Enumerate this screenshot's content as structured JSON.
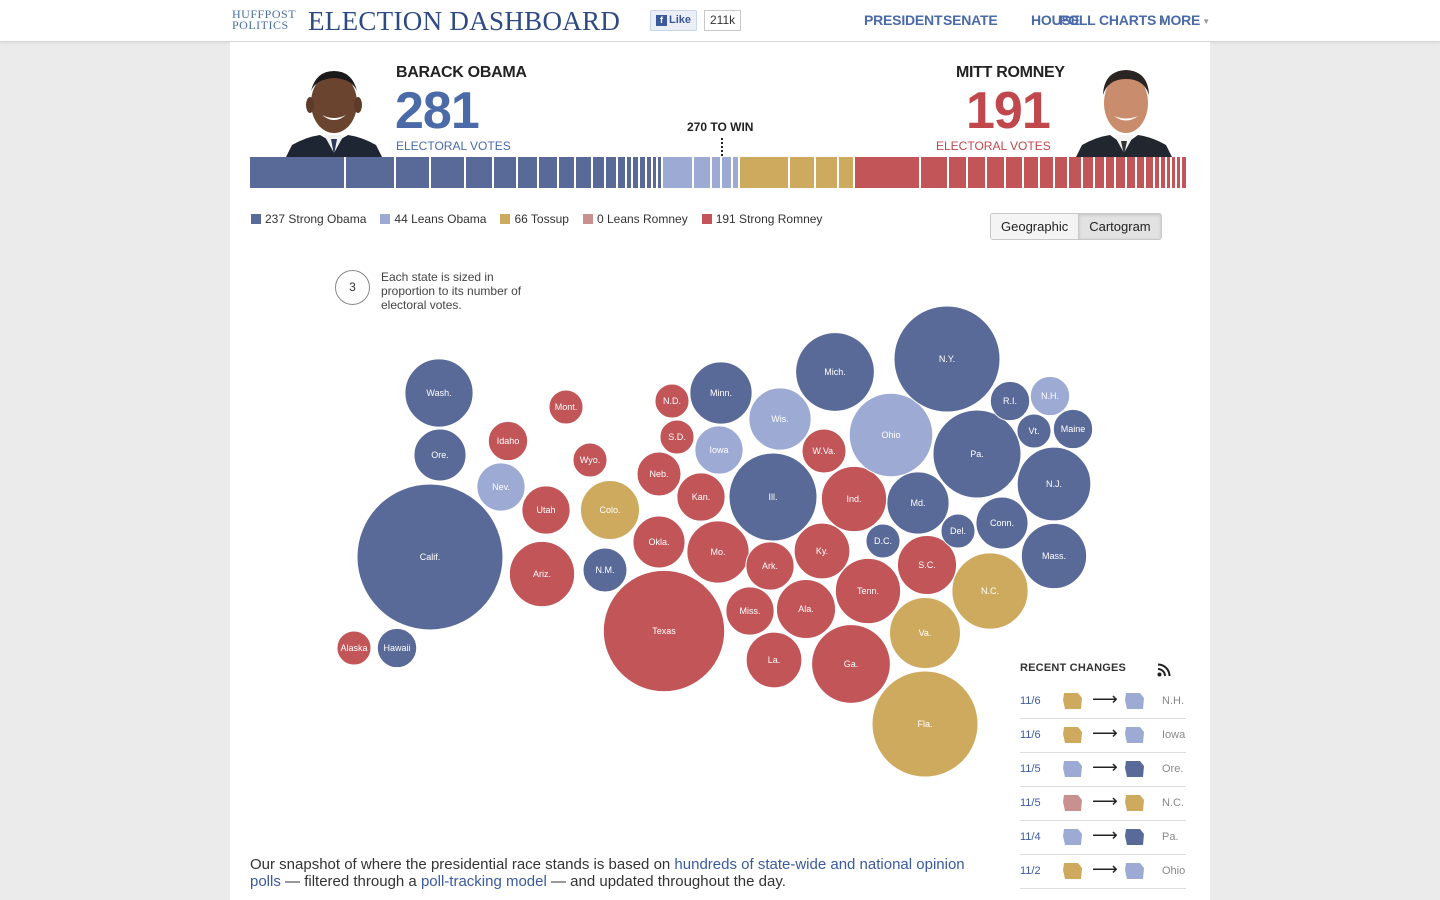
{
  "colors": {
    "strong_obama": "#5a6a98",
    "leans_obama": "#9daad4",
    "tossup": "#ceaa5e",
    "leans_romney": "#c99090",
    "strong_romney": "#c15558",
    "obama_text": "#4a6aa8",
    "romney_text": "#c0474c"
  },
  "header": {
    "logo_line1": "HUFFPOST",
    "logo_line2": "POLITICS",
    "title": "ELECTION DASHBOARD",
    "fb_like": "Like",
    "fb_count": "211k",
    "nav": [
      "PRESIDENT",
      "SENATE",
      "HOUSE",
      "POLL CHARTS",
      "MORE"
    ]
  },
  "obama": {
    "name": "BARACK OBAMA",
    "votes": "281",
    "label": "ELECTORAL VOTES"
  },
  "romney": {
    "name": "MITT ROMNEY",
    "votes": "191",
    "label": "ELECTORAL VOTES"
  },
  "to_win": "270 TO WIN",
  "legend": [
    {
      "key": "strong_obama",
      "label": "237 Strong Obama",
      "count": 237
    },
    {
      "key": "leans_obama",
      "label": "44 Leans Obama",
      "count": 44
    },
    {
      "key": "tossup",
      "label": "66 Tossup",
      "count": 66
    },
    {
      "key": "leans_romney",
      "label": "0 Leans Romney",
      "count": 0
    },
    {
      "key": "strong_romney",
      "label": "191 Strong Romney",
      "count": 191
    }
  ],
  "view_toggle": {
    "options": [
      "Geographic",
      "Cartogram"
    ],
    "selected": "Cartogram"
  },
  "size_note": {
    "example_votes": "3",
    "text": "Each state is sized in proportion to its number of electoral votes."
  },
  "states": [
    {
      "label": "Wash.",
      "ev": 12,
      "cat": "strong_obama"
    },
    {
      "label": "Ore.",
      "ev": 7,
      "cat": "strong_obama"
    },
    {
      "label": "Calif.",
      "ev": 55,
      "cat": "strong_obama"
    },
    {
      "label": "Alaska",
      "ev": 3,
      "cat": "strong_romney"
    },
    {
      "label": "Hawaii",
      "ev": 4,
      "cat": "strong_obama"
    },
    {
      "label": "Idaho",
      "ev": 4,
      "cat": "strong_romney"
    },
    {
      "label": "Nev.",
      "ev": 6,
      "cat": "leans_obama"
    },
    {
      "label": "Mont.",
      "ev": 3,
      "cat": "strong_romney"
    },
    {
      "label": "Wyo.",
      "ev": 3,
      "cat": "strong_romney"
    },
    {
      "label": "Utah",
      "ev": 6,
      "cat": "strong_romney"
    },
    {
      "label": "Colo.",
      "ev": 9,
      "cat": "tossup"
    },
    {
      "label": "Ariz.",
      "ev": 11,
      "cat": "strong_romney"
    },
    {
      "label": "N.M.",
      "ev": 5,
      "cat": "strong_obama"
    },
    {
      "label": "N.D.",
      "ev": 3,
      "cat": "strong_romney"
    },
    {
      "label": "S.D.",
      "ev": 3,
      "cat": "strong_romney"
    },
    {
      "label": "Neb.",
      "ev": 5,
      "cat": "strong_romney"
    },
    {
      "label": "Kan.",
      "ev": 6,
      "cat": "strong_romney"
    },
    {
      "label": "Okla.",
      "ev": 7,
      "cat": "strong_romney"
    },
    {
      "label": "Texas",
      "ev": 38,
      "cat": "strong_romney"
    },
    {
      "label": "Minn.",
      "ev": 10,
      "cat": "strong_obama"
    },
    {
      "label": "Iowa",
      "ev": 6,
      "cat": "leans_obama"
    },
    {
      "label": "Mo.",
      "ev": 10,
      "cat": "strong_romney"
    },
    {
      "label": "Ark.",
      "ev": 6,
      "cat": "strong_romney"
    },
    {
      "label": "La.",
      "ev": 8,
      "cat": "strong_romney"
    },
    {
      "label": "Miss.",
      "ev": 6,
      "cat": "strong_romney"
    },
    {
      "label": "Wis.",
      "ev": 10,
      "cat": "leans_obama"
    },
    {
      "label": "Ill.",
      "ev": 20,
      "cat": "strong_obama"
    },
    {
      "label": "Mich.",
      "ev": 16,
      "cat": "strong_obama"
    },
    {
      "label": "Ind.",
      "ev": 11,
      "cat": "strong_romney"
    },
    {
      "label": "Ky.",
      "ev": 8,
      "cat": "strong_romney"
    },
    {
      "label": "Tenn.",
      "ev": 11,
      "cat": "strong_romney"
    },
    {
      "label": "Ala.",
      "ev": 9,
      "cat": "strong_romney"
    },
    {
      "label": "Ga.",
      "ev": 16,
      "cat": "strong_romney"
    },
    {
      "label": "Fla.",
      "ev": 29,
      "cat": "tossup"
    },
    {
      "label": "Ohio",
      "ev": 18,
      "cat": "leans_obama"
    },
    {
      "label": "W.Va.",
      "ev": 5,
      "cat": "strong_romney"
    },
    {
      "label": "Va.",
      "ev": 13,
      "cat": "tossup"
    },
    {
      "label": "N.C.",
      "ev": 15,
      "cat": "tossup"
    },
    {
      "label": "S.C.",
      "ev": 9,
      "cat": "strong_romney"
    },
    {
      "label": "Pa.",
      "ev": 20,
      "cat": "strong_obama"
    },
    {
      "label": "N.Y.",
      "ev": 29,
      "cat": "strong_obama"
    },
    {
      "label": "Md.",
      "ev": 10,
      "cat": "strong_obama"
    },
    {
      "label": "Del.",
      "ev": 3,
      "cat": "strong_obama"
    },
    {
      "label": "D.C.",
      "ev": 3,
      "cat": "strong_obama"
    },
    {
      "label": "N.J.",
      "ev": 14,
      "cat": "strong_obama"
    },
    {
      "label": "Conn.",
      "ev": 7,
      "cat": "strong_obama"
    },
    {
      "label": "Mass.",
      "ev": 11,
      "cat": "strong_obama"
    },
    {
      "label": "R.I.",
      "ev": 4,
      "cat": "strong_obama"
    },
    {
      "label": "Vt.",
      "ev": 3,
      "cat": "strong_obama"
    },
    {
      "label": "N.H.",
      "ev": 4,
      "cat": "leans_obama"
    },
    {
      "label": "Maine",
      "ev": 4,
      "cat": "strong_obama"
    }
  ],
  "recent_changes": {
    "title": "RECENT CHANGES",
    "items": [
      {
        "date": "11/6",
        "state": "N.H.",
        "from": "tossup",
        "to": "leans_obama"
      },
      {
        "date": "11/6",
        "state": "Iowa",
        "from": "tossup",
        "to": "leans_obama"
      },
      {
        "date": "11/5",
        "state": "Ore.",
        "from": "leans_obama",
        "to": "strong_obama"
      },
      {
        "date": "11/5",
        "state": "N.C.",
        "from": "leans_romney",
        "to": "tossup"
      },
      {
        "date": "11/4",
        "state": "Pa.",
        "from": "leans_obama",
        "to": "strong_obama"
      },
      {
        "date": "11/2",
        "state": "Ohio",
        "from": "tossup",
        "to": "leans_obama"
      }
    ]
  },
  "footer": {
    "t1": "Our snapshot of where the presidential race stands is based on ",
    "l1": "hundreds of state-wide and national opinion polls",
    "t2": " — filtered through a ",
    "l2": "poll-tracking model",
    "t3": " — and updated throughout the day."
  }
}
